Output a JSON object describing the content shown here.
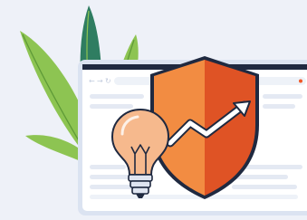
{
  "illustration": {
    "colors": {
      "background": "#eef1f8",
      "browser_frame": "#dbe3f1",
      "browser_bar": "#1f2940",
      "browser_page": "#ffffff",
      "placeholder_line": "#e4e9f3",
      "address_bar": "#eef2f8",
      "dot_accent": "#f05a28",
      "shield_left": "#f28c42",
      "shield_right": "#df5325",
      "shield_outline": "#1f2940",
      "trend_arrow": "#ffffff",
      "bulb_glass": "#f6b98d",
      "bulb_glass_outline": "#1f2940",
      "bulb_base": "#dfe5f1",
      "leaf_light": "#8dc452",
      "leaf_dark": "#2f7d61",
      "leaf_vein": "#5e9a37"
    },
    "icons": [
      "browser-window",
      "security-shield-icon",
      "trend-up-arrow-icon",
      "lightbulb-icon",
      "back-arrow-icon",
      "forward-arrow-icon",
      "refresh-icon",
      "leaves-decoration"
    ]
  }
}
